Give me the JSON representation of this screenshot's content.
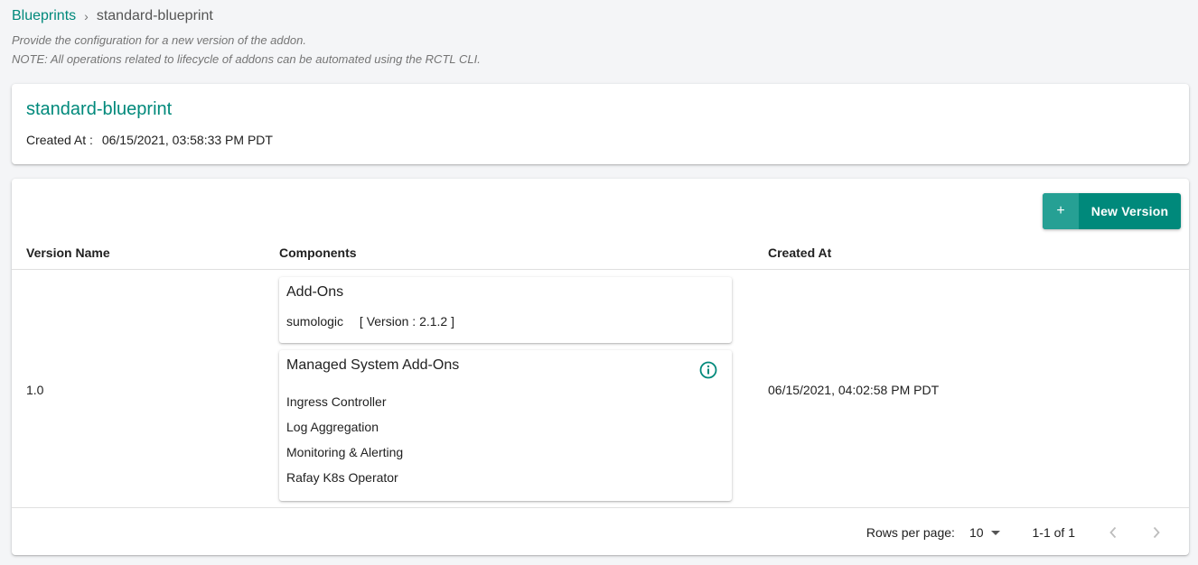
{
  "breadcrumb": {
    "link": "Blueprints",
    "separator": "›",
    "current": "standard-blueprint"
  },
  "description": {
    "line1": "Provide the configuration for a new version of the addon.",
    "line2": "NOTE: All operations related to lifecycle of addons can be automated using the RCTL CLI."
  },
  "blueprint": {
    "name": "standard-blueprint",
    "created_label": "Created At :",
    "created_value": "06/15/2021, 03:58:33 PM PDT"
  },
  "toolbar": {
    "plus": "+",
    "new_version_label": "New Version"
  },
  "table": {
    "columns": [
      "Version Name",
      "Components",
      "Created At"
    ],
    "rows": [
      {
        "version": "1.0",
        "created_at": "06/15/2021, 04:02:58 PM PDT",
        "addons": {
          "title": "Add-Ons",
          "items": [
            {
              "name": "sumologic",
              "version": "[ Version : 2.1.2 ]"
            }
          ]
        },
        "managed": {
          "title": "Managed System Add-Ons",
          "items": [
            "Ingress Controller",
            "Log Aggregation",
            "Monitoring & Alerting",
            "Rafay K8s Operator"
          ]
        }
      }
    ]
  },
  "pagination": {
    "rows_per_page_label": "Rows per page:",
    "rows_per_page_value": "10",
    "range": "1-1 of 1"
  },
  "colors": {
    "accent": "#00897b",
    "background": "#f4f5f7"
  },
  "icons": {
    "info": "info-circle-icon",
    "prev": "chevron-left-icon",
    "next": "chevron-right-icon",
    "dropdown": "caret-down-icon"
  }
}
